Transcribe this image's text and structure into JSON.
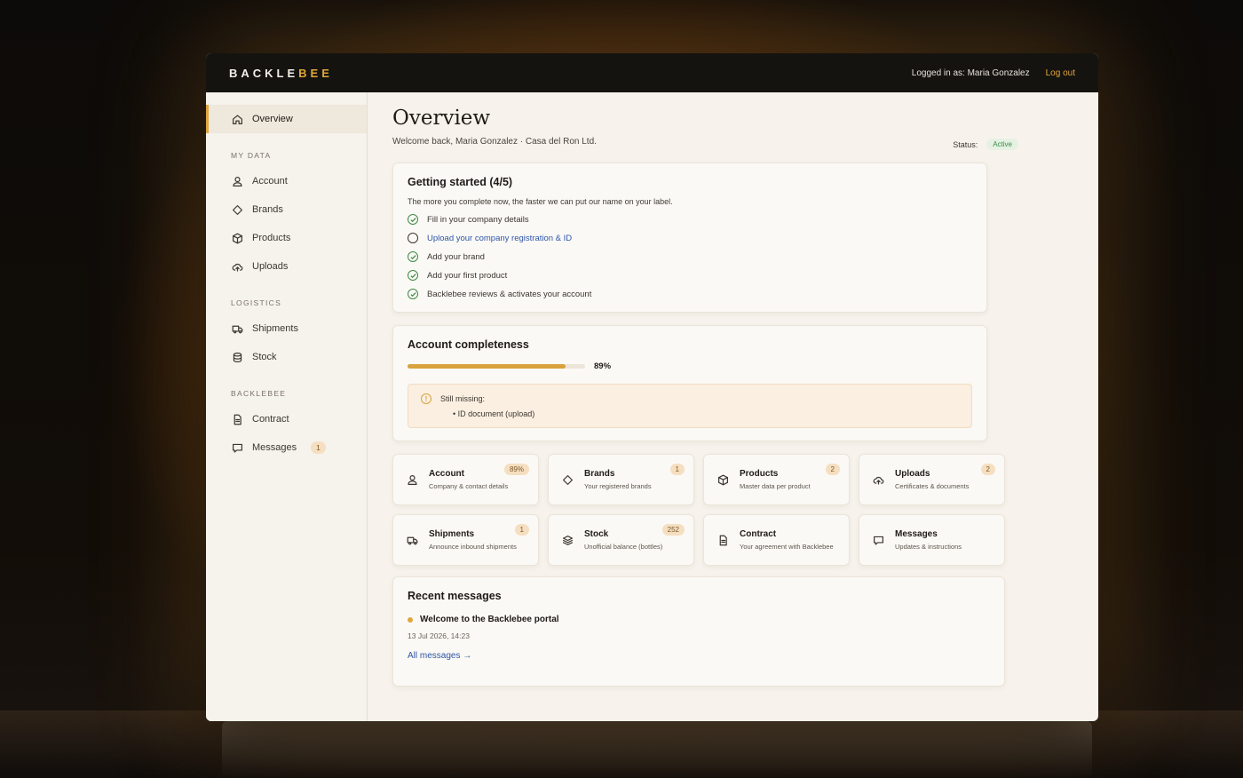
{
  "app": {
    "logo_text": "BACKLE",
    "logo_accent": "BEE",
    "logged_in": "Logged in as: Maria Gonzalez",
    "logout": "Log out",
    "colors": {
      "accent": "#e0a63a",
      "status_green": "#3f8a45",
      "link": "#2d55a8"
    }
  },
  "sidebar": {
    "overview": "Overview",
    "section_my_data": "MY DATA",
    "account": "Account",
    "brands": "Brands",
    "products": "Products",
    "uploads": "Uploads",
    "section_logistics": "LOGISTICS",
    "shipments": "Shipments",
    "stock": "Stock",
    "section_backlebee": "BACKLEBEE",
    "contract": "Contract",
    "messages": "Messages",
    "messages_badge": "1"
  },
  "main": {
    "title": "Overview",
    "welcome": "Welcome back, Maria Gonzalez · Casa del Ron Ltd.",
    "status_label": "Status:",
    "status_value": "Active"
  },
  "getting_started": {
    "title": "Getting started (4/5)",
    "subtitle": "The more you complete now, the faster we can put our name on your label.",
    "items": [
      {
        "label": "Fill in your company details",
        "done": true
      },
      {
        "label": "Upload your company registration & ID",
        "done": false
      },
      {
        "label": "Add your brand",
        "done": true
      },
      {
        "label": "Add your first product",
        "done": true
      },
      {
        "label": "Backlebee reviews & activates your account",
        "done": true
      }
    ]
  },
  "completeness": {
    "title": "Account completeness",
    "percent": 0.89,
    "percent_label": "89%",
    "missing_title": "Still missing:",
    "missing_item": "ID document (upload)"
  },
  "tiles": [
    {
      "title": "Account",
      "sub": "Company & contact details",
      "badge": "89%",
      "icon": "user-icon"
    },
    {
      "title": "Brands",
      "sub": "Your registered brands",
      "badge": "1",
      "icon": "tag-icon"
    },
    {
      "title": "Products",
      "sub": "Master data per product",
      "badge": "2",
      "icon": "box-icon"
    },
    {
      "title": "Uploads",
      "sub": "Certificates & documents",
      "badge": "2",
      "icon": "cloud-upload-icon"
    },
    {
      "title": "Shipments",
      "sub": "Announce inbound shipments",
      "badge": "1",
      "icon": "truck-icon"
    },
    {
      "title": "Stock",
      "sub": "Unofficial balance (bottles)",
      "badge": "252",
      "icon": "layers-icon"
    },
    {
      "title": "Contract",
      "sub": "Your agreement with Backlebee",
      "badge": "",
      "icon": "document-icon"
    },
    {
      "title": "Messages",
      "sub": "Updates & instructions",
      "badge": "",
      "icon": "chat-icon"
    }
  ],
  "recent": {
    "title": "Recent messages",
    "message_title": "Welcome to the Backlebee portal",
    "message_date": "13 Jul 2026, 14:23",
    "all_link": "All messages →"
  }
}
